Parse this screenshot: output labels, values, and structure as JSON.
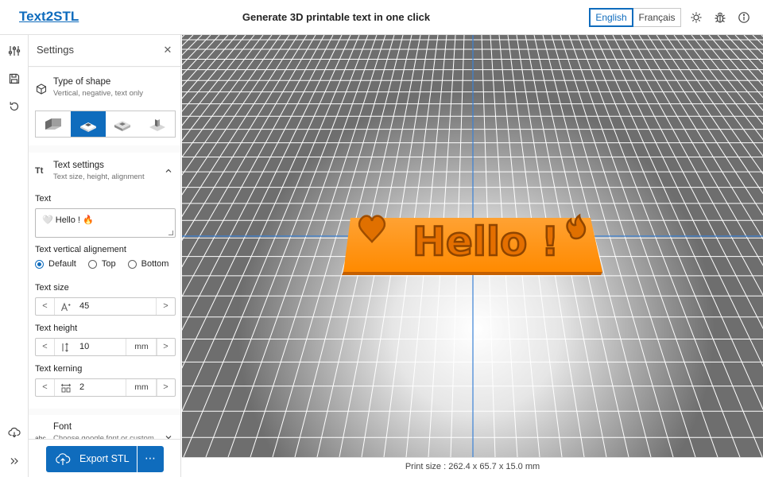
{
  "app": {
    "logo": "Text2STL",
    "tagline": "Generate 3D printable text in one click",
    "languages": [
      "English",
      "Français"
    ],
    "active_language": "English",
    "accent_color": "#0f6cbd",
    "model_color": "#ff8c00"
  },
  "header_icons": [
    "sun-icon",
    "bug-icon",
    "info-icon"
  ],
  "rail_icons": [
    "settings-sliders-icon",
    "save-icon",
    "reset-icon",
    "download-cloud-icon",
    "expand-icon"
  ],
  "panel": {
    "title": "Settings",
    "close_glyph": "✕",
    "shape": {
      "title": "Type of shape",
      "subtitle": "Vertical, negative, text only",
      "options": [
        "vertical",
        "negative",
        "plate",
        "text-only"
      ],
      "selected_index": 1
    },
    "text_settings": {
      "title": "Text settings",
      "subtitle": "Text size, height, alignment",
      "text_label": "Text",
      "text_value": "🤍 Hello ! 🔥",
      "vertical_label": "Text vertical alignement",
      "vertical_options": [
        "Default",
        "Top",
        "Bottom"
      ],
      "vertical_selected": "Default",
      "size_label": "Text size",
      "size_value": "45",
      "height_label": "Text height",
      "height_value": "10",
      "height_unit": "mm",
      "kerning_label": "Text kerning",
      "kerning_value": "2",
      "kerning_unit": "mm"
    },
    "font": {
      "title": "Font",
      "subtitle": "Choose google font or custom"
    },
    "export_label": "Export STL",
    "export_more": "⋯"
  },
  "viewport": {
    "model_text": "Hello !",
    "status": "Print size : 262.4 x 65.7 x 15.0 mm"
  }
}
